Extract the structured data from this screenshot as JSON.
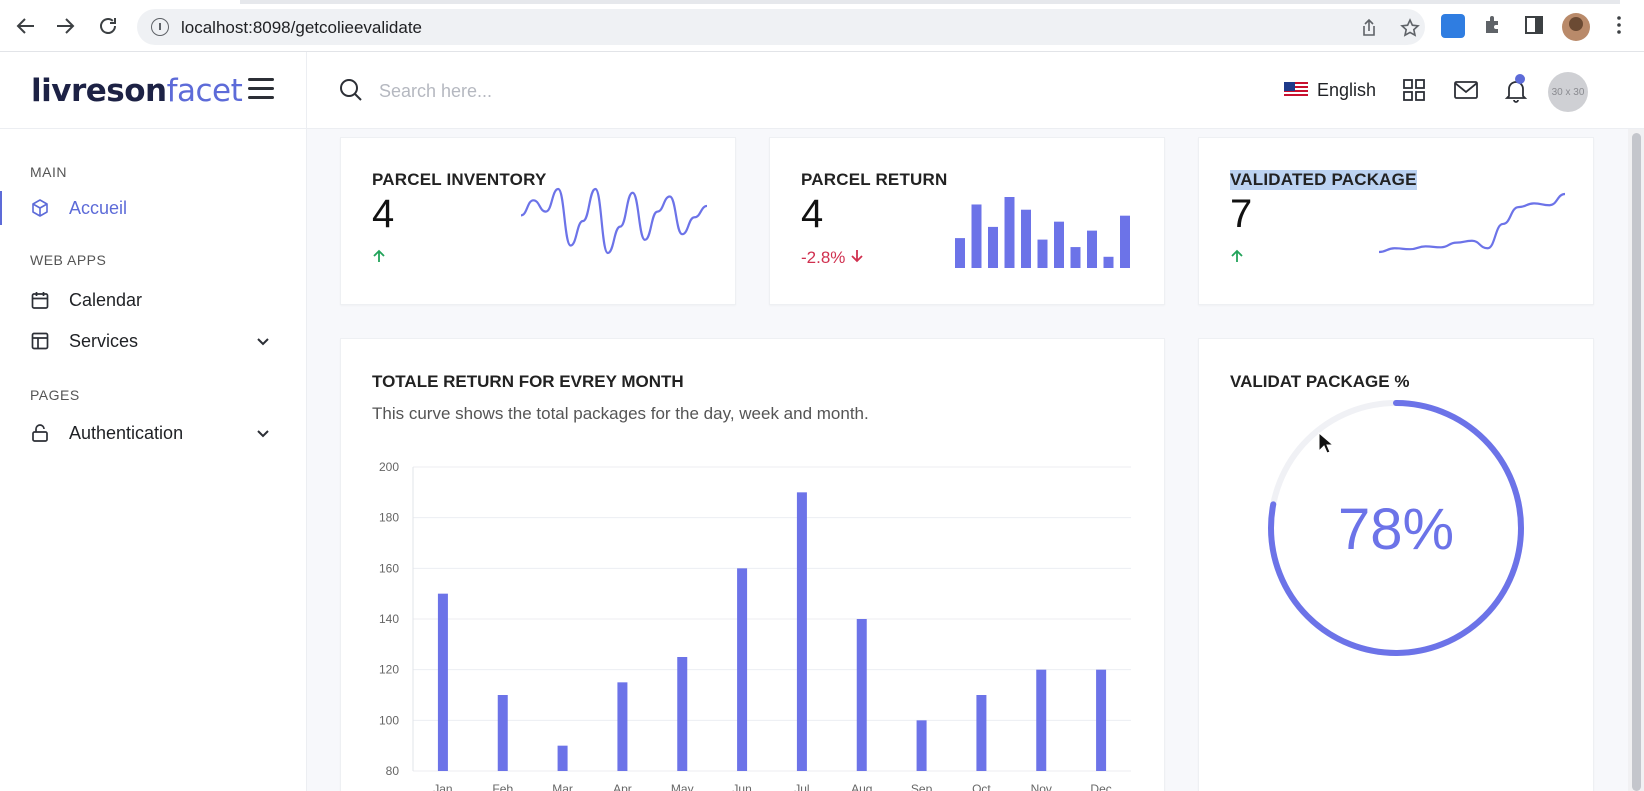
{
  "browser": {
    "url": "localhost:8098/getcolieevalidate"
  },
  "sidebar": {
    "logo_bold": "livreson",
    "logo_light": "facet",
    "sections": {
      "main": "MAIN",
      "web_apps": "WEB APPS",
      "pages": "PAGES"
    },
    "items": {
      "accueil": "Accueil",
      "calendar": "Calendar",
      "services": "Services",
      "authentication": "Authentication"
    }
  },
  "header": {
    "search_placeholder": "Search here...",
    "language": "English",
    "avatar_text": "30 x 30"
  },
  "stats": [
    {
      "title": "PARCEL INVENTORY",
      "value": "4",
      "trend": "",
      "trend_dir": "up",
      "spark": "line"
    },
    {
      "title": "PARCEL RETURN",
      "value": "4",
      "trend": "-2.8%",
      "trend_dir": "down",
      "spark": "bar"
    },
    {
      "title": "VALIDATED PACKAGE",
      "value": "7",
      "trend": "",
      "trend_dir": "up",
      "spark": "line"
    }
  ],
  "monthly_chart": {
    "title": "TOTALE RETURN FOR EVREY MONTH",
    "subtitle": "This curve shows the total packages for the day, week and month."
  },
  "gauge": {
    "title": "VALIDAT PACKAGE %",
    "value_label": "78%",
    "percent": 78
  },
  "colors": {
    "accent": "#5d6bd8",
    "bar": "#6c73e8",
    "up": "#22a35a",
    "down": "#d0304f"
  },
  "chart_data": [
    {
      "type": "bar",
      "categories": [
        "Jan",
        "Feb",
        "Mar",
        "Apr",
        "May",
        "Jun",
        "Jul",
        "Aug",
        "Sep",
        "Oct",
        "Nov",
        "Dec"
      ],
      "values": [
        150,
        110,
        90,
        115,
        125,
        160,
        190,
        140,
        100,
        110,
        120,
        120
      ],
      "ylim": [
        80,
        200
      ],
      "yticks": [
        80,
        100,
        120,
        140,
        160,
        180,
        200
      ],
      "grid": true
    },
    {
      "type": "line",
      "values": [
        58,
        66,
        60,
        72,
        42,
        55,
        72,
        38,
        52,
        70,
        45,
        60,
        68,
        48,
        57,
        63
      ]
    },
    {
      "type": "bar",
      "values": [
        40,
        85,
        55,
        95,
        78,
        38,
        62,
        28,
        50,
        15,
        70
      ]
    },
    {
      "type": "line",
      "values": [
        10,
        14,
        13,
        16,
        15,
        20,
        22,
        14,
        40,
        58,
        62,
        60,
        72
      ]
    }
  ]
}
